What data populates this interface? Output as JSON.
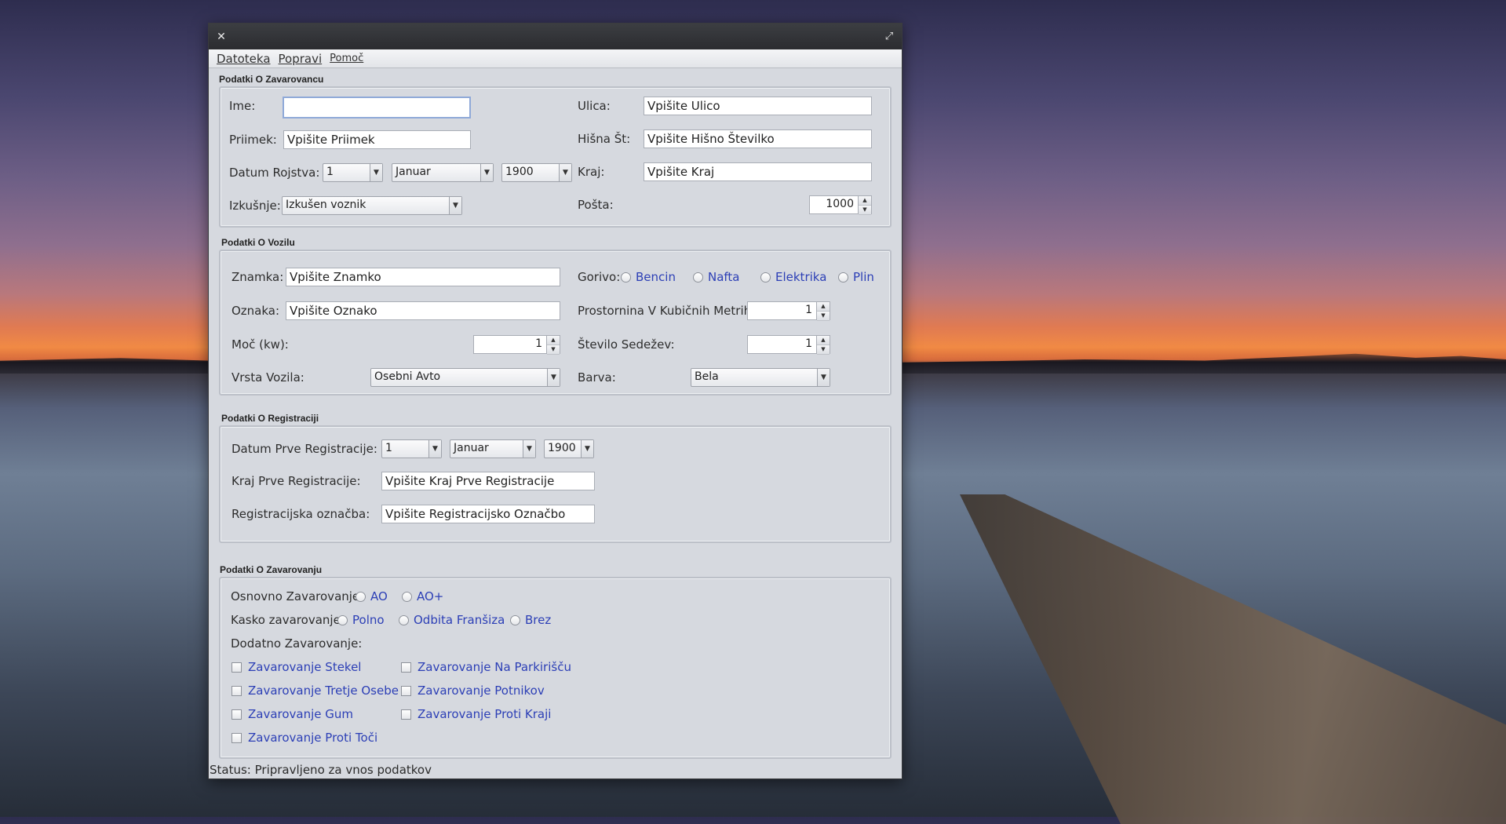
{
  "window": {
    "menu": [
      "Datoteka",
      "Popravi",
      "Pomoč"
    ]
  },
  "zavarovanec": {
    "title": "Podatki O Zavarovancu",
    "ime_label": "Ime:",
    "ime_value": "",
    "priimek_label": "Priimek:",
    "priimek_value": "Vpišite Priimek",
    "datum_label": "Datum Rojstva:",
    "datum_dan": "1",
    "datum_mesec": "Januar",
    "datum_leto": "1900",
    "izkusnje_label": "Izkušnje:",
    "izkusnje_value": "Izkušen voznik",
    "ulica_label": "Ulica:",
    "ulica_value": "Vpišite Ulico",
    "hisna_label": "Hišna Št:",
    "hisna_value": "Vpišite Hišno Številko",
    "kraj_label": "Kraj:",
    "kraj_value": "Vpišite Kraj",
    "posta_label": "Pošta:",
    "posta_value": "1000"
  },
  "vozilo": {
    "title": "Podatki O Vozilu",
    "znamka_label": "Znamka:",
    "znamka_value": "Vpišite Znamko",
    "oznaka_label": "Oznaka:",
    "oznaka_value": "Vpišite Oznako",
    "moc_label": "Moč (kw):",
    "moc_value": "1",
    "vrsta_label": "Vrsta Vozila:",
    "vrsta_value": "Osebni Avto",
    "gorivo_label": "Gorivo:",
    "gorivo_options": [
      "Bencin",
      "Nafta",
      "Elektrika",
      "Plin"
    ],
    "prostornina_label": "Prostornina V Kubičnih Metrih:",
    "prostornina_value": "1",
    "sedezi_label": "Število Sedežev:",
    "sedezi_value": "1",
    "barva_label": "Barva:",
    "barva_value": "Bela"
  },
  "registracija": {
    "title": "Podatki O Registraciji",
    "datum_label": "Datum Prve Registracije:",
    "datum_dan": "1",
    "datum_mesec": "Januar",
    "datum_leto": "1900",
    "kraj_label": "Kraj Prve Registracije:",
    "kraj_value": "Vpišite Kraj Prve Registracije",
    "oznacba_label": "Registracijska označba:",
    "oznacba_value": "Vpišite Registracijsko Označbo"
  },
  "zavarovanje": {
    "title": "Podatki O Zavarovanju",
    "osnovno_label": "Osnovno Zavarovanje:",
    "osnovno_options": [
      "AO",
      "AO+"
    ],
    "kasko_label": "Kasko zavarovanje:",
    "kasko_options": [
      "Polno",
      "Odbita Franšiza",
      "Brez"
    ],
    "dodatno_label": "Dodatno Zavarovanje:",
    "dodatno_options": [
      "Zavarovanje Stekel",
      "Zavarovanje Na Parkirišču",
      "Zavarovanje Tretje Osebe",
      "Zavarovanje Potnikov",
      "Zavarovanje Gum",
      "Zavarovanje Proti Kraji",
      "Zavarovanje Proti Toči"
    ]
  },
  "status": "Status: Pripravljeno za vnos podatkov"
}
